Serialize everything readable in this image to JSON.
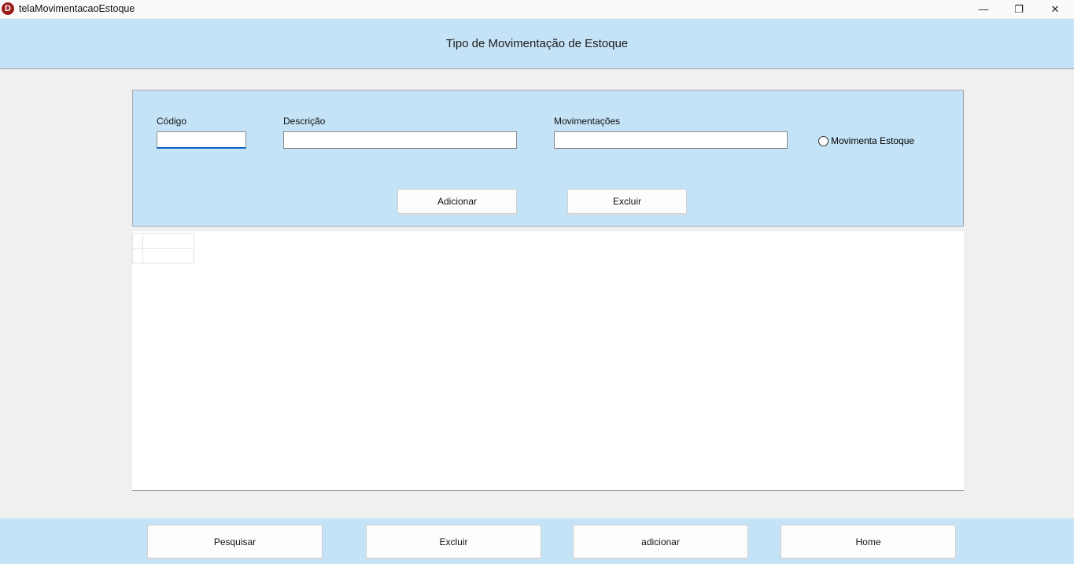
{
  "window": {
    "title": "telaMovimentacaoEstoque",
    "app_icon_letter": "D",
    "controls": {
      "minimize": "—",
      "restore": "❐",
      "close": "✕"
    }
  },
  "header": {
    "title": "Tipo de Movimentação de Estoque"
  },
  "form": {
    "codigo_label": "Código",
    "codigo_value": "",
    "descricao_label": "Descrição",
    "descricao_value": "",
    "movimentacoes_label": "Movimentações",
    "movimentacoes_value": "",
    "movimenta_estoque_label": "Movimenta Estoque",
    "movimenta_estoque_checked": false,
    "adicionar_label": "Adicionar",
    "excluir_label": "Excluir"
  },
  "table": {
    "rows": [],
    "columns": []
  },
  "footer": {
    "pesquisar_label": "Pesquisar",
    "excluir_label": "Excluir",
    "adicionar_label": "adicionar",
    "home_label": "Home"
  },
  "colors": {
    "panel_blue": "#c5e3f7",
    "background": "#f0f0f0",
    "focus_accent": "#0a5fc9",
    "app_icon": "#9b1b1b"
  }
}
